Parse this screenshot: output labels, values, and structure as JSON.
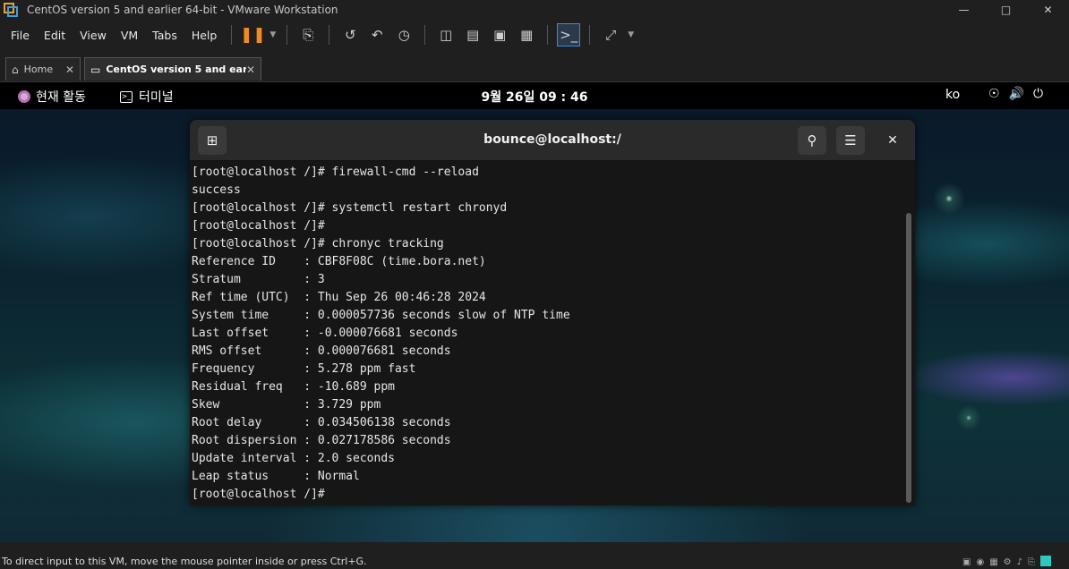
{
  "window": {
    "title": "CentOS version 5 and earlier 64-bit - VMware Workstation"
  },
  "menu": {
    "items": [
      "File",
      "Edit",
      "View",
      "VM",
      "Tabs",
      "Help"
    ]
  },
  "tabs": [
    {
      "label": "Home"
    },
    {
      "label": "CentOS version 5 and earl..."
    }
  ],
  "gnome": {
    "activities": "현재 활동",
    "app": "터미널",
    "clock": "9월 26일 09 : 46",
    "lang": "ko"
  },
  "terminal": {
    "title": "bounce@localhost:/",
    "lines": [
      "[root@localhost /]# firewall-cmd --reload",
      "success",
      "[root@localhost /]# systemctl restart chronyd",
      "[root@localhost /]#",
      "[root@localhost /]# chronyc tracking",
      "Reference ID    : CBF8F08C (time.bora.net)",
      "Stratum         : 3",
      "Ref time (UTC)  : Thu Sep 26 00:46:28 2024",
      "System time     : 0.000057736 seconds slow of NTP time",
      "Last offset     : -0.000076681 seconds",
      "RMS offset      : 0.000076681 seconds",
      "Frequency       : 5.278 ppm fast",
      "Residual freq   : -10.689 ppm",
      "Skew            : 3.729 ppm",
      "Root delay      : 0.034506138 seconds",
      "Root dispersion : 0.027178586 seconds",
      "Update interval : 2.0 seconds",
      "Leap status     : Normal",
      "[root@localhost /]#"
    ]
  },
  "status": {
    "text": "To direct input to this VM, move the mouse pointer inside or press Ctrl+G."
  }
}
